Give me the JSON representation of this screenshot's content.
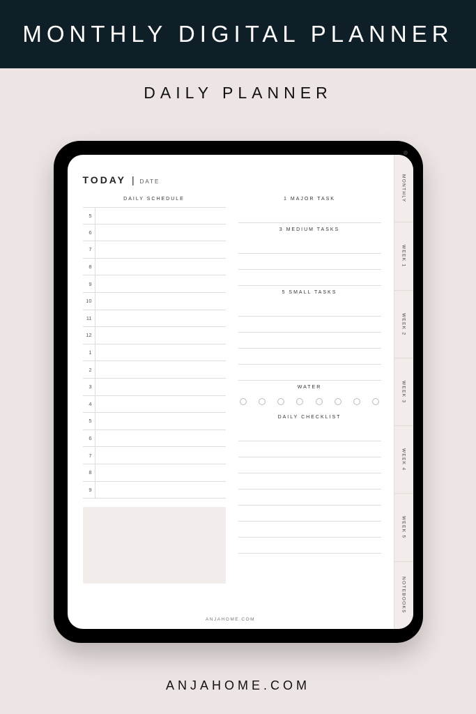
{
  "header": {
    "title": "MONTHLY DIGITAL PLANNER"
  },
  "subheader": {
    "title": "DAILY PLANNER"
  },
  "page": {
    "today_label": "TODAY",
    "date_label": "DATE",
    "schedule_title": "DAILY SCHEDULE",
    "hours": [
      "5",
      "6",
      "7",
      "8",
      "9",
      "10",
      "11",
      "12",
      "1",
      "2",
      "3",
      "4",
      "5",
      "6",
      "7",
      "8",
      "9"
    ],
    "major_task_title": "1 MAJOR TASK",
    "medium_tasks_title": "3 MEDIUM TASKS",
    "small_tasks_title": "5 SMALL TASKS",
    "water_title": "WATER",
    "water_count": 8,
    "checklist_title": "DAILY CHECKLIST",
    "footer": "ANJAHOME.COM"
  },
  "tabs": [
    "MONTHLY",
    "WEEK 1",
    "WEEK 2",
    "WEEK 3",
    "WEEK 4",
    "WEEK 5",
    "NOTEBOOKS"
  ],
  "brand": "ANJAHOME.COM"
}
